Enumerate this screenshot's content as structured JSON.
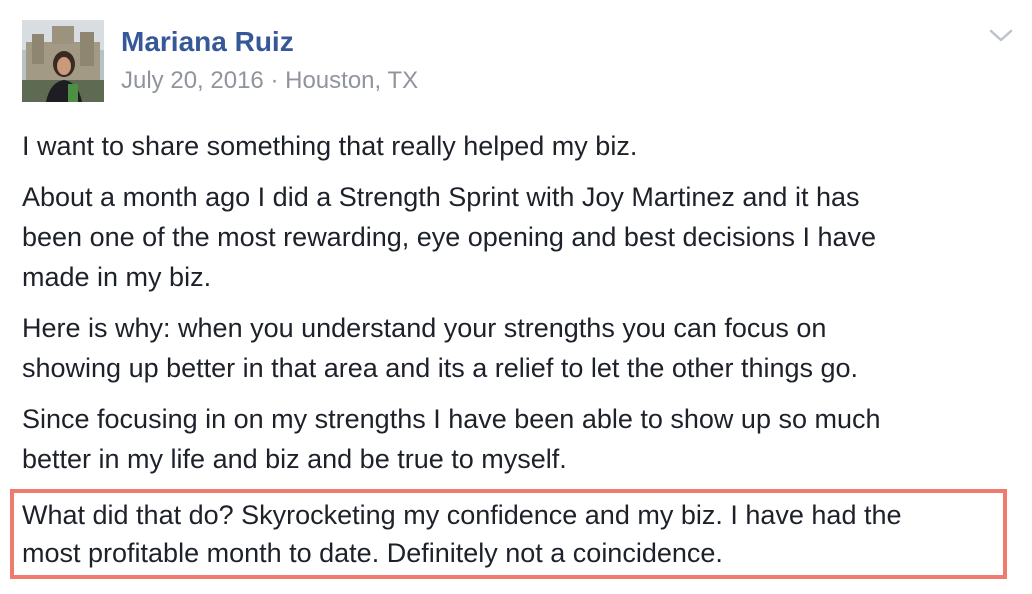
{
  "post": {
    "author": "Mariana Ruiz",
    "date": "July 20, 2016",
    "separator": "·",
    "location": "Houston, TX",
    "menu_icon": "chevron-down-icon",
    "paragraphs": [
      [
        "I want to share something that really helped my biz."
      ],
      [
        "About a month ago I did a Strength Sprint with Joy Martinez and it has",
        "been one of the most rewarding, eye opening and best decisions I have",
        "made in my biz."
      ],
      [
        "Here is why: when you understand your strengths you can focus on",
        "showing up better in that area and its a relief to let the other things go."
      ],
      [
        "Since focusing in on my strengths I have been able to show up so much",
        "better in my life and biz and be true to myself."
      ]
    ],
    "highlighted_paragraph": [
      "What did that do? Skyrocketing my confidence and my biz. I have had the",
      "most profitable month to date. Definitely not a coincidence."
    ]
  },
  "colors": {
    "author_link": "#365899",
    "meta_text": "#90949c",
    "body_text": "#1d2129",
    "highlight_border": "#f07a6e"
  }
}
